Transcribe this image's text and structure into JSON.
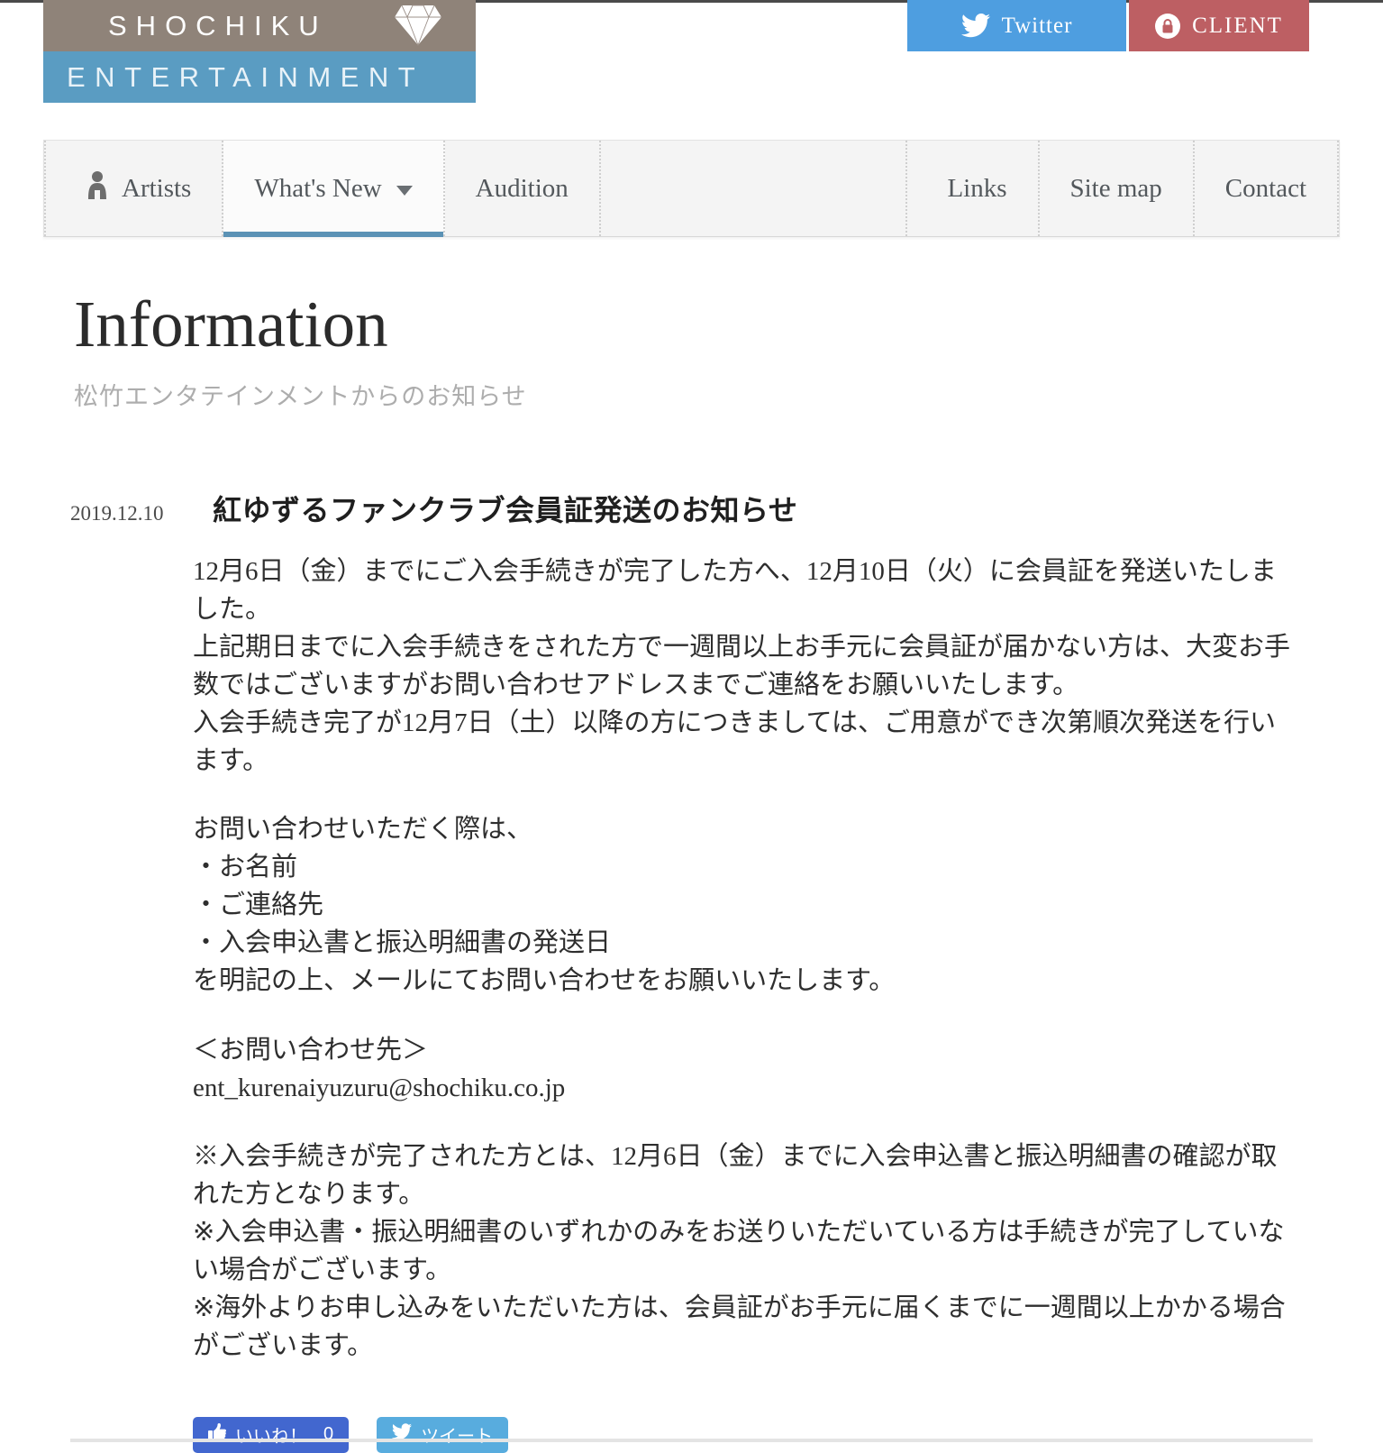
{
  "header": {
    "logo_top": "SHOCHIKU",
    "logo_bottom": "ENTERTAINMENT",
    "diamond_icon": "diamond-icon",
    "twitter_label": "Twitter",
    "client_label": "CLIENT",
    "twitter_color": "#4e9ee0",
    "client_color": "#bd5f63",
    "logo_top_color": "#8f8379",
    "logo_bottom_color": "#5a9cc2"
  },
  "nav": {
    "left_items": [
      {
        "label": "Artists",
        "icon": "person-icon",
        "active": false,
        "caret": false
      },
      {
        "label": "What's New",
        "icon": "",
        "active": true,
        "caret": true
      },
      {
        "label": "Audition",
        "icon": "",
        "active": false,
        "caret": false
      }
    ],
    "right_items": [
      {
        "label": "Links"
      },
      {
        "label": "Site map"
      },
      {
        "label": "Contact"
      }
    ],
    "active_underline_color": "#5b92b5"
  },
  "page": {
    "title": "Information",
    "subtitle": "松竹エンタテインメントからのお知らせ"
  },
  "article": {
    "date": "2019.12.10",
    "title": "紅ゆずるファンクラブ会員証発送のお知らせ",
    "paragraphs": [
      "12月6日（金）までにご入会手続きが完了した方へ、12月10日（火）に会員証を発送いたしました。\n上記期日までに入会手続きをされた方で一週間以上お手元に会員証が届かない方は、大変お手数ではございますがお問い合わせアドレスまでご連絡をお願いいたします。\n入会手続き完了が12月7日（土）以降の方につきましては、ご用意ができ次第順次発送を行います。",
      "お問い合わせいただく際は、\n・お名前\n・ご連絡先\n・入会申込書と振込明細書の発送日\nを明記の上、メールにてお問い合わせをお願いいたします。",
      "＜お問い合わせ先＞\nent_kurenaiyuzuru@shochiku.co.jp",
      "※入会手続きが完了された方とは、12月6日（金）までに入会申込書と振込明細書の確認が取れた方となります。\n※入会申込書・振込明細書のいずれかのみをお送りいただいている方は手続きが完了していない場合がございます。\n※海外よりお申し込みをいただいた方は、会員証がお手元に届くまでに一週間以上かかる場合がございます。"
    ]
  },
  "share": {
    "like_label": "いいね！",
    "like_count": "0",
    "like_icon": "thumbs-up-icon",
    "like_color": "#4267cf",
    "tweet_label": "ツイート",
    "tweet_icon": "twitter-bird-icon",
    "tweet_color": "#58acde"
  }
}
